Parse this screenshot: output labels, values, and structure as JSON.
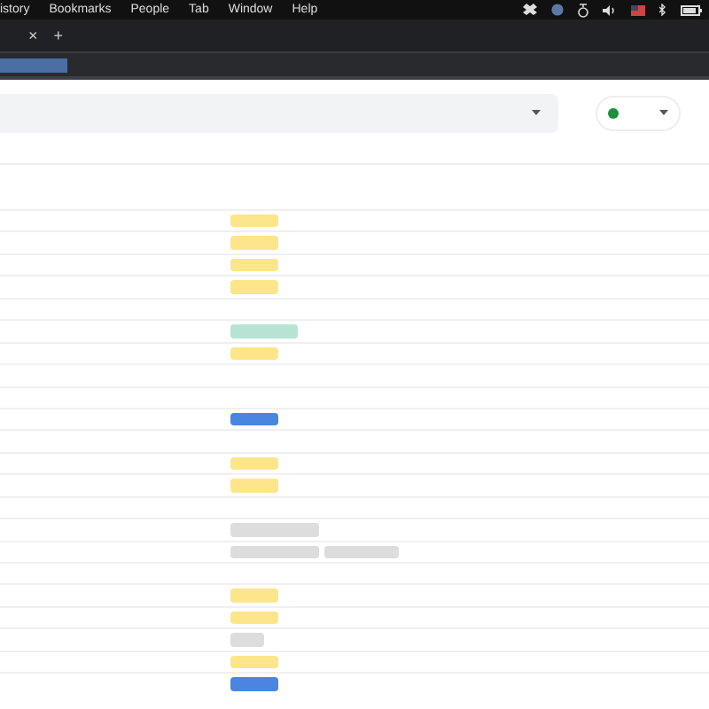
{
  "menu_bar": {
    "items": [
      "istory",
      "Bookmarks",
      "People",
      "Tab",
      "Window",
      "Help"
    ]
  },
  "tab_strip": {
    "close": "×",
    "new_tab": "+"
  },
  "toolbar": {
    "highlight": {
      "selected": true
    }
  },
  "filter": {
    "status_dot": {
      "color": "#1e8e3e"
    }
  },
  "rows": [
    {
      "tags": [
        {
          "kind": "short",
          "color": "#fde68a"
        }
      ]
    },
    {
      "tags": [
        {
          "kind": "short",
          "color": "#fde68a"
        }
      ]
    },
    {
      "tags": [
        {
          "kind": "short",
          "color": "#fde68a"
        }
      ]
    },
    {
      "tags": [
        {
          "kind": "short",
          "color": "#fde68a"
        }
      ]
    },
    {
      "tags": []
    },
    {
      "tags": [
        {
          "kind": "medium",
          "color": "#b7e4d2"
        }
      ]
    },
    {
      "tags": [
        {
          "kind": "short",
          "color": "#fde68a"
        }
      ]
    },
    {
      "tags": []
    },
    {
      "tags": []
    },
    {
      "tags": [
        {
          "kind": "short",
          "color": "#4a86e0"
        }
      ]
    },
    {
      "tags": []
    },
    {
      "tags": [
        {
          "kind": "short",
          "color": "#fde68a"
        }
      ]
    },
    {
      "tags": [
        {
          "kind": "short",
          "color": "#fde68a"
        }
      ]
    },
    {
      "tags": []
    },
    {
      "tags": [
        {
          "kind": "long",
          "color": "#dddddd"
        }
      ]
    },
    {
      "tags": [
        {
          "kind": "long",
          "color": "#dddddd"
        },
        {
          "kind": "wide",
          "color": "#dddddd"
        }
      ]
    },
    {
      "tags": []
    },
    {
      "tags": [
        {
          "kind": "short",
          "color": "#fde68a"
        }
      ]
    },
    {
      "tags": [
        {
          "kind": "short",
          "color": "#fde68a"
        }
      ]
    },
    {
      "tags": [
        {
          "kind": "tiny",
          "color": "#dddddd"
        }
      ]
    },
    {
      "tags": [
        {
          "kind": "short",
          "color": "#fde68a"
        }
      ]
    },
    {
      "tags": [
        {
          "kind": "short",
          "color": "#4a86e0"
        }
      ]
    }
  ]
}
